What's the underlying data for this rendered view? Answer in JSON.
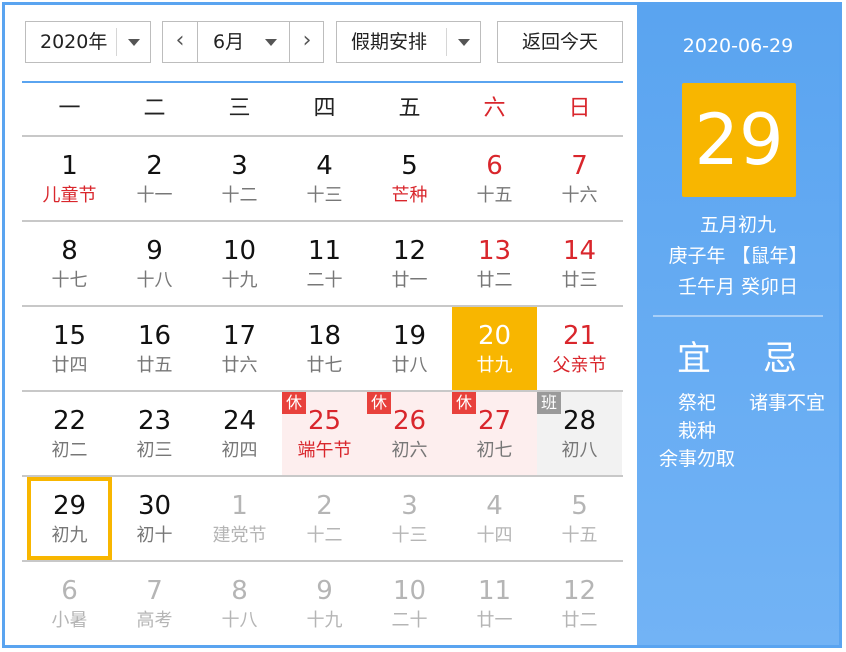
{
  "toolbar": {
    "year": "2020年",
    "month": "6月",
    "prev_symbol": "‹",
    "next_symbol": "›",
    "holiday": "假期安排",
    "today_button": "返回今天"
  },
  "weekdays": [
    "一",
    "二",
    "三",
    "四",
    "五",
    "六",
    "日"
  ],
  "weeks": [
    [
      {
        "d": "1",
        "l": "儿童节",
        "red_lunar": true
      },
      {
        "d": "2",
        "l": "十一"
      },
      {
        "d": "3",
        "l": "十二"
      },
      {
        "d": "4",
        "l": "十三"
      },
      {
        "d": "5",
        "l": "芒种",
        "red_lunar": true
      },
      {
        "d": "6",
        "l": "十五",
        "weekend": true
      },
      {
        "d": "7",
        "l": "十六",
        "weekend": true
      }
    ],
    [
      {
        "d": "8",
        "l": "十七"
      },
      {
        "d": "9",
        "l": "十八"
      },
      {
        "d": "10",
        "l": "十九"
      },
      {
        "d": "11",
        "l": "二十"
      },
      {
        "d": "12",
        "l": "廿一"
      },
      {
        "d": "13",
        "l": "廿二",
        "weekend": true
      },
      {
        "d": "14",
        "l": "廿三",
        "weekend": true
      }
    ],
    [
      {
        "d": "15",
        "l": "廿四"
      },
      {
        "d": "16",
        "l": "廿五"
      },
      {
        "d": "17",
        "l": "廿六"
      },
      {
        "d": "18",
        "l": "廿七"
      },
      {
        "d": "19",
        "l": "廿八"
      },
      {
        "d": "20",
        "l": "廿九",
        "weekend": true,
        "selected": true
      },
      {
        "d": "21",
        "l": "父亲节",
        "weekend": true,
        "red_lunar": true
      }
    ],
    [
      {
        "d": "22",
        "l": "初二"
      },
      {
        "d": "23",
        "l": "初三"
      },
      {
        "d": "24",
        "l": "初四"
      },
      {
        "d": "25",
        "l": "端午节",
        "weekend": true,
        "red_lunar": true,
        "holiday": true,
        "tag": "休"
      },
      {
        "d": "26",
        "l": "初六",
        "weekend": true,
        "holiday": true,
        "tag": "休"
      },
      {
        "d": "27",
        "l": "初七",
        "weekend": true,
        "holiday": true,
        "tag": "休"
      },
      {
        "d": "28",
        "l": "初八",
        "workday": true,
        "tag": "班"
      }
    ],
    [
      {
        "d": "29",
        "l": "初九",
        "today": true
      },
      {
        "d": "30",
        "l": "初十"
      },
      {
        "d": "1",
        "l": "建党节",
        "other": true
      },
      {
        "d": "2",
        "l": "十二",
        "other": true
      },
      {
        "d": "3",
        "l": "十三",
        "other": true
      },
      {
        "d": "4",
        "l": "十四",
        "other": true
      },
      {
        "d": "5",
        "l": "十五",
        "other": true
      }
    ],
    [
      {
        "d": "6",
        "l": "小暑",
        "other": true
      },
      {
        "d": "7",
        "l": "高考",
        "other": true
      },
      {
        "d": "8",
        "l": "十八",
        "other": true
      },
      {
        "d": "9",
        "l": "十九",
        "other": true
      },
      {
        "d": "10",
        "l": "二十",
        "other": true
      },
      {
        "d": "11",
        "l": "廿一",
        "other": true
      },
      {
        "d": "12",
        "l": "廿二",
        "other": true
      }
    ]
  ],
  "panel": {
    "date": "2020-06-29",
    "day": "29",
    "lunar": "五月初九",
    "year_gz": "庚子年 【鼠年】",
    "month_day_gz": "壬午月 癸卯日",
    "yi_title": "宜",
    "ji_title": "忌",
    "yi_items": [
      "祭祀",
      "栽种",
      "余事勿取"
    ],
    "ji_items": [
      "诸事不宜"
    ]
  },
  "colors": {
    "accent": "#5aa4f0",
    "selected": "#f8b600",
    "weekend_red": "#d9262c",
    "rest_tag": "#e8413c",
    "work_tag": "#9a9a9a"
  }
}
